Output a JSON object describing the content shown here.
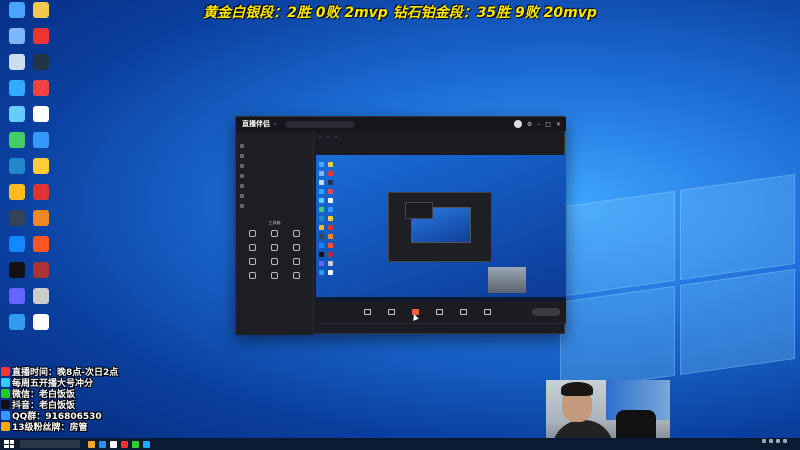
{
  "overlay_title": "黄金白银段：2胜 0败   2mvp   钻石铂金段：35胜 9败   20mvp",
  "desktop_icons": [
    {
      "label": "",
      "color": "#4aa3ff"
    },
    {
      "label": "",
      "color": "#f2c94c"
    },
    {
      "label": "",
      "color": "#7db8ff"
    },
    {
      "label": "",
      "color": "#e33"
    },
    {
      "label": "",
      "color": "#cde"
    },
    {
      "label": "",
      "color": "#234"
    },
    {
      "label": "",
      "color": "#3af"
    },
    {
      "label": "",
      "color": "#e44"
    },
    {
      "label": "",
      "color": "#6cf"
    },
    {
      "label": "",
      "color": "#fff"
    },
    {
      "label": "",
      "color": "#4c6"
    },
    {
      "label": "",
      "color": "#39f"
    },
    {
      "label": "",
      "color": "#28c"
    },
    {
      "label": "",
      "color": "#fc3"
    },
    {
      "label": "",
      "color": "#fb2"
    },
    {
      "label": "",
      "color": "#d33"
    },
    {
      "label": "",
      "color": "#345"
    },
    {
      "label": "",
      "color": "#e82"
    },
    {
      "label": "",
      "color": "#18f"
    },
    {
      "label": "",
      "color": "#f52"
    },
    {
      "label": "",
      "color": "#111"
    },
    {
      "label": "",
      "color": "#a33"
    },
    {
      "label": "",
      "color": "#66f"
    },
    {
      "label": "",
      "color": "#ccc"
    },
    {
      "label": "",
      "color": "#39e"
    },
    {
      "label": "",
      "color": "#fff"
    }
  ],
  "app": {
    "logo": "直播伴侣",
    "logo_badge": "",
    "search_placeholder": "",
    "tabs": [
      "",
      "",
      ""
    ],
    "scenes": [
      "",
      "",
      "",
      "",
      "",
      "",
      ""
    ],
    "tools_title": "工具箱",
    "tools": [
      "",
      "",
      "",
      "",
      "",
      "",
      "",
      "",
      "",
      "",
      "",
      ""
    ],
    "bottom_note": "",
    "header_line1": "",
    "header_chips": [
      "",
      "",
      "",
      "",
      "",
      ""
    ],
    "preview_overlay": "",
    "bottom_buttons": [
      "",
      "",
      "",
      "",
      "",
      ""
    ],
    "active_button_index": 2,
    "go_live": "",
    "status": ""
  },
  "info_lines": [
    {
      "text": "直播时间：晚8点-次日2点",
      "color": "#f33"
    },
    {
      "text": "每周五开播大号冲分",
      "color": "#3cf"
    },
    {
      "text": "微信：老白饭饭",
      "color": "#2c2"
    },
    {
      "text": "抖音：老白饭饭",
      "color": "#111"
    },
    {
      "text": "QQ群：916806530",
      "color": "#39f"
    },
    {
      "text": "13级粉丝牌：房管",
      "color": "#fa0"
    }
  ],
  "taskbar_apps": [
    "#f5a623",
    "#2d8cff",
    "#fff",
    "#e33",
    "#3c3",
    "#2af"
  ],
  "clock": {
    "time": "",
    "date": ""
  }
}
